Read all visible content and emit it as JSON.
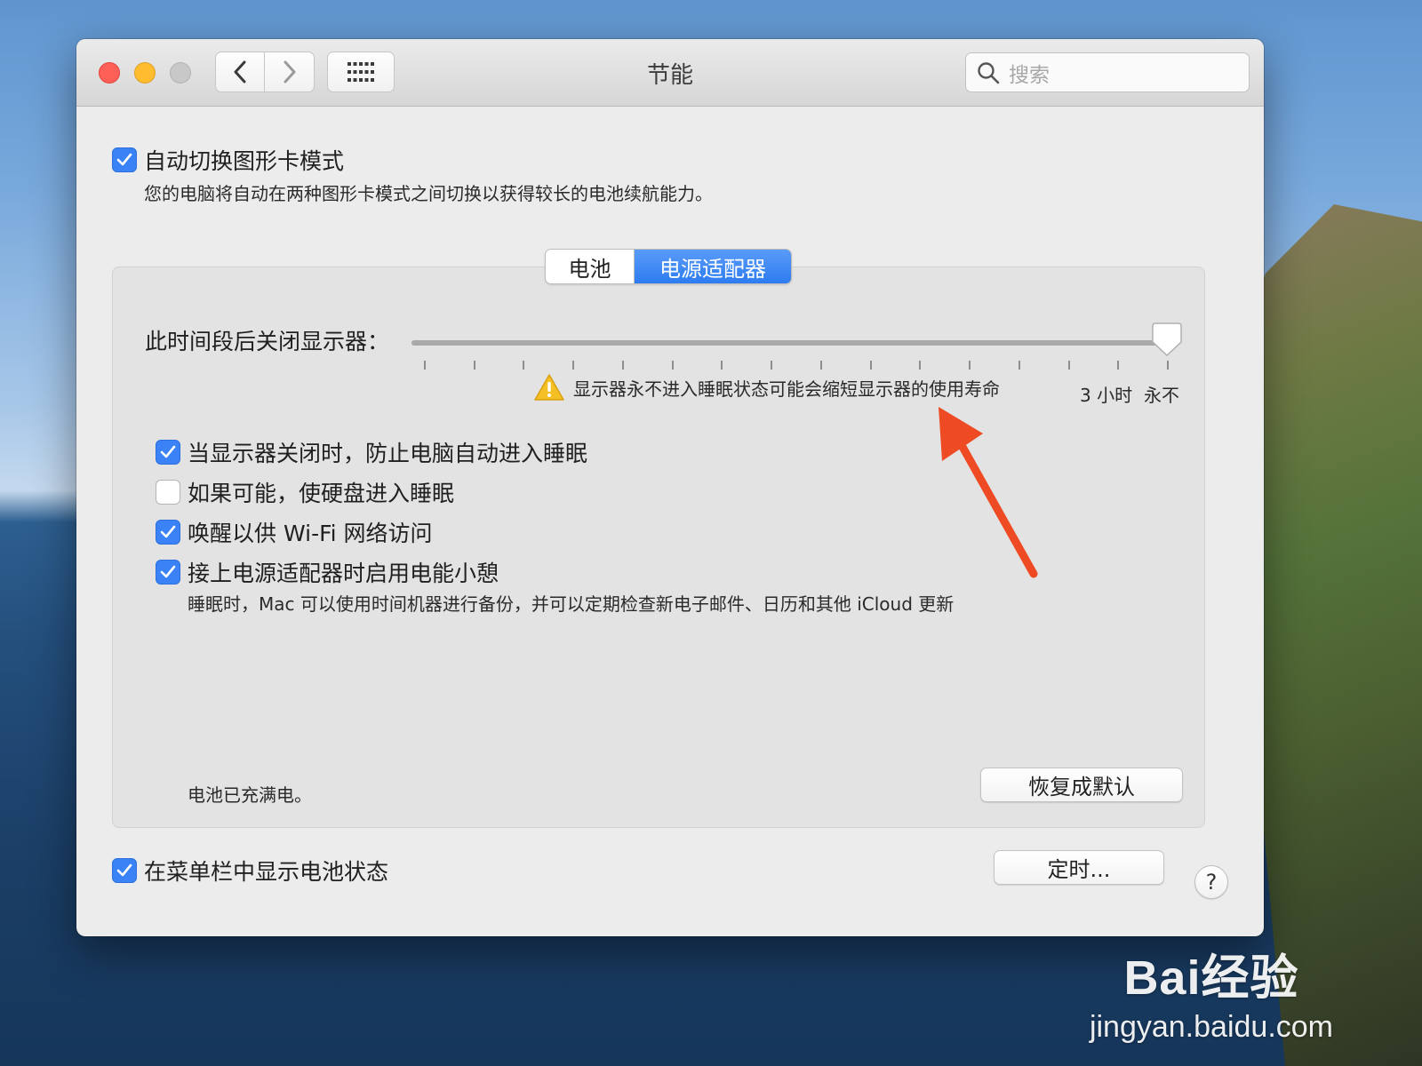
{
  "window": {
    "title": "节能",
    "search_placeholder": "搜索"
  },
  "graphics_switching": {
    "label": "自动切换图形卡模式",
    "checked": true,
    "description": "您的电脑将自动在两种图形卡模式之间切换以获得较长的电池续航能力。"
  },
  "tabs": [
    {
      "label": "电池",
      "selected": false
    },
    {
      "label": "电源适配器",
      "selected": true
    }
  ],
  "display_sleep": {
    "label": "此时间段后关闭显示器：",
    "value_fraction": 1.0,
    "tick_count": 16,
    "tick_labels": [
      "3 小时",
      "永不"
    ],
    "warning": "显示器永不进入睡眠状态可能会缩短显示器的使用寿命"
  },
  "options": [
    {
      "label": "当显示器关闭时，防止电脑自动进入睡眠",
      "checked": true
    },
    {
      "label": "如果可能，使硬盘进入睡眠",
      "checked": false
    },
    {
      "label": "唤醒以供 Wi-Fi 网络访问",
      "checked": true
    },
    {
      "label": "接上电源适配器时启用电能小憩",
      "checked": true,
      "description": "睡眠时，Mac 可以使用时间机器进行备份，并可以定期检查新电子邮件、日历和其他 iCloud 更新"
    }
  ],
  "battery_status": "电池已充满电。",
  "buttons": {
    "restore_defaults": "恢复成默认",
    "schedule": "定时...",
    "help": "?"
  },
  "menu_bar_battery": {
    "label": "在菜单栏中显示电池状态",
    "checked": true
  },
  "colors": {
    "accent": "#3b82f6",
    "annotation_arrow": "#ee4a23"
  },
  "watermark": {
    "logo_text": "Bai经验",
    "url": "jingyan.baidu.com"
  }
}
